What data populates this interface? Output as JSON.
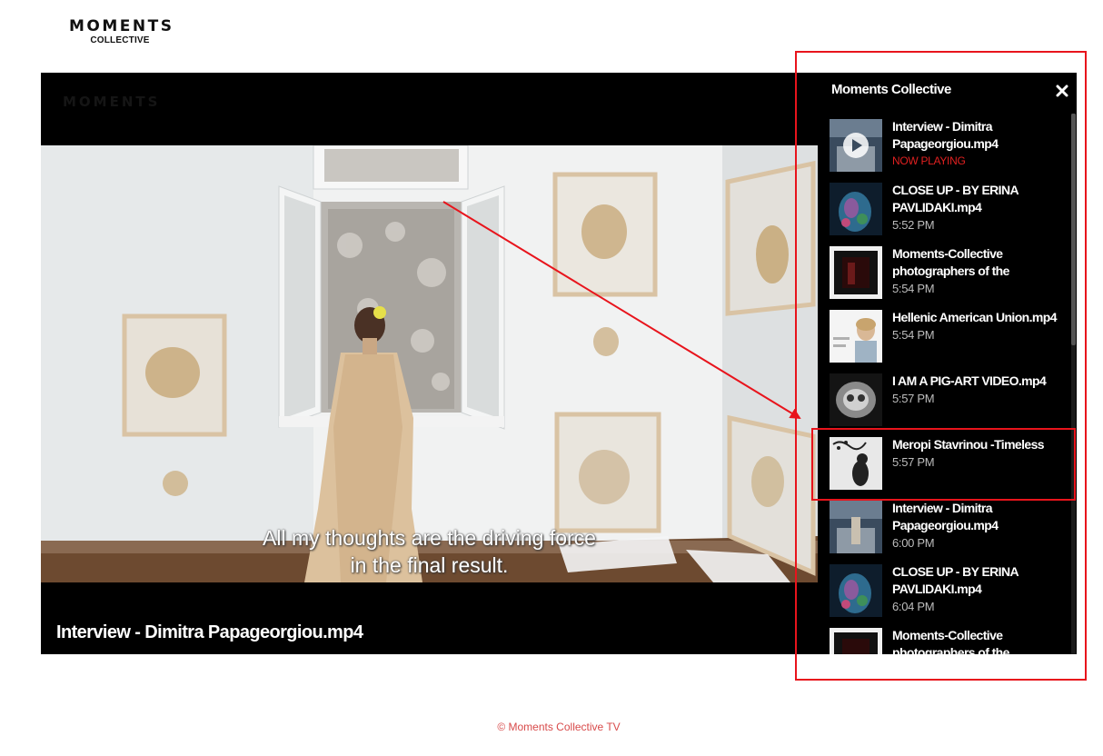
{
  "brand": {
    "logo_main": "MOMENTS",
    "logo_sub": "COLLECTIVE",
    "watermark": "MOMENTS"
  },
  "player": {
    "title": "Interview - Dimitra Papageorgiou.mp4",
    "subtitle_line1": "All my thoughts are the driving force",
    "subtitle_line2": "in the final result."
  },
  "playlist": {
    "header": "Moments Collective",
    "close_icon": "close-icon",
    "items": [
      {
        "title": "Interview - Dimitra Papageorgiou.mp4",
        "time": "NOW PLAYING",
        "now_playing": true,
        "thumb": "play-icon-thumb"
      },
      {
        "title": "CLOSE UP - BY ERINA PAVLIDAKI.mp4",
        "time": "5:52 PM"
      },
      {
        "title": "Moments-Collective photographers of the",
        "time": "5:54 PM"
      },
      {
        "title": "Hellenic American Union.mp4",
        "time": "5:54 PM"
      },
      {
        "title": "I AM A PIG-ART VIDEO.mp4",
        "time": "5:57 PM"
      },
      {
        "title": "Meropi Stavrinou -Timeless",
        "time": "5:57 PM"
      },
      {
        "title": "Interview - Dimitra Papageorgiou.mp4",
        "time": "6:00 PM"
      },
      {
        "title": "CLOSE UP - BY ERINA PAVLIDAKI.mp4",
        "time": "6:04 PM"
      },
      {
        "title": "Moments-Collective photographers of the",
        "time": ""
      }
    ]
  },
  "footer": {
    "text": "© Moments Collective TV"
  },
  "colors": {
    "accent_red": "#e02020",
    "annotation_red": "#e8141c",
    "footer_red": "#d84a4a"
  }
}
